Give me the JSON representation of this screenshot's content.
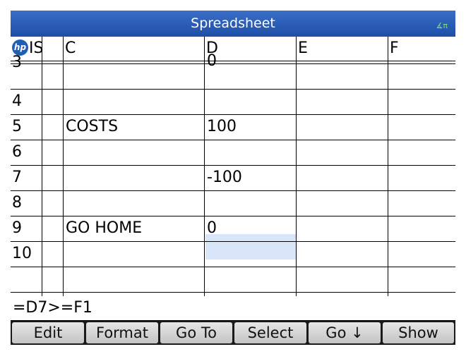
{
  "title": "Spreadsheet",
  "angle_mode_indicator": "∡π",
  "header": {
    "logo": "hp",
    "columns": [
      "IS",
      "C",
      "D",
      "E",
      "F"
    ]
  },
  "rows": [
    {
      "num": "3",
      "c": "",
      "d": "0"
    },
    {
      "num": "4",
      "c": "",
      "d": ""
    },
    {
      "num": "5",
      "c": "COSTS",
      "d": "100"
    },
    {
      "num": "6",
      "c": "",
      "d": ""
    },
    {
      "num": "7",
      "c": "",
      "d": "-100"
    },
    {
      "num": "8",
      "c": "",
      "d": ""
    },
    {
      "num": "9",
      "c": "GO HOME",
      "d": "0"
    },
    {
      "num": "10",
      "c": "",
      "d": ""
    }
  ],
  "formula": "=D7>=F1",
  "menu": [
    "Edit",
    "Format",
    "Go To",
    "Select",
    "Go ↓",
    "Show"
  ],
  "colors": {
    "title_bar": "#2a5fba",
    "selected_cell": "#d9e6f9",
    "angle_indicator": "#7fe07f"
  }
}
